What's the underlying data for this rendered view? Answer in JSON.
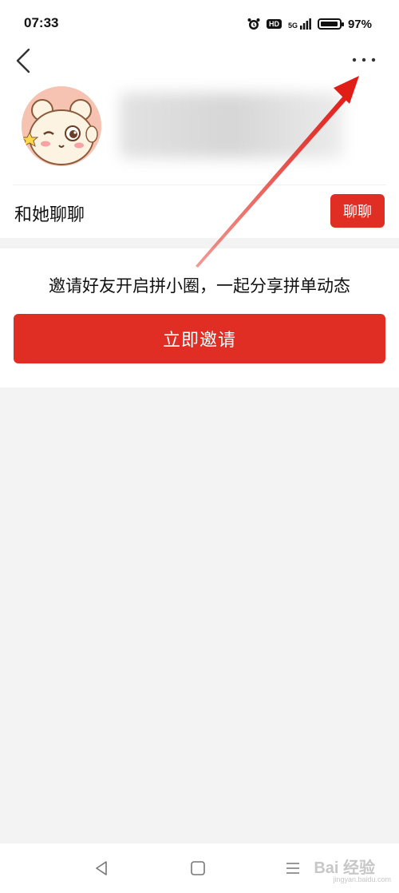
{
  "status": {
    "time": "07:33",
    "hd": "HD",
    "network": "5G",
    "battery": "97%"
  },
  "icons": {
    "back": "chevron-left-icon",
    "more": "more-dots-icon",
    "alarm": "alarm-icon",
    "signal": "signal-icon"
  },
  "chat": {
    "label": "和她聊聊",
    "button": "聊聊"
  },
  "invite": {
    "text": "邀请好友开启拼小圈，一起分享拼单动态",
    "button": "立即邀请"
  },
  "watermark": {
    "brand": "Bai  经验",
    "url": "jingyan.baidu.com"
  },
  "colors": {
    "accent": "#e02e24",
    "background": "#f3f3f3"
  }
}
